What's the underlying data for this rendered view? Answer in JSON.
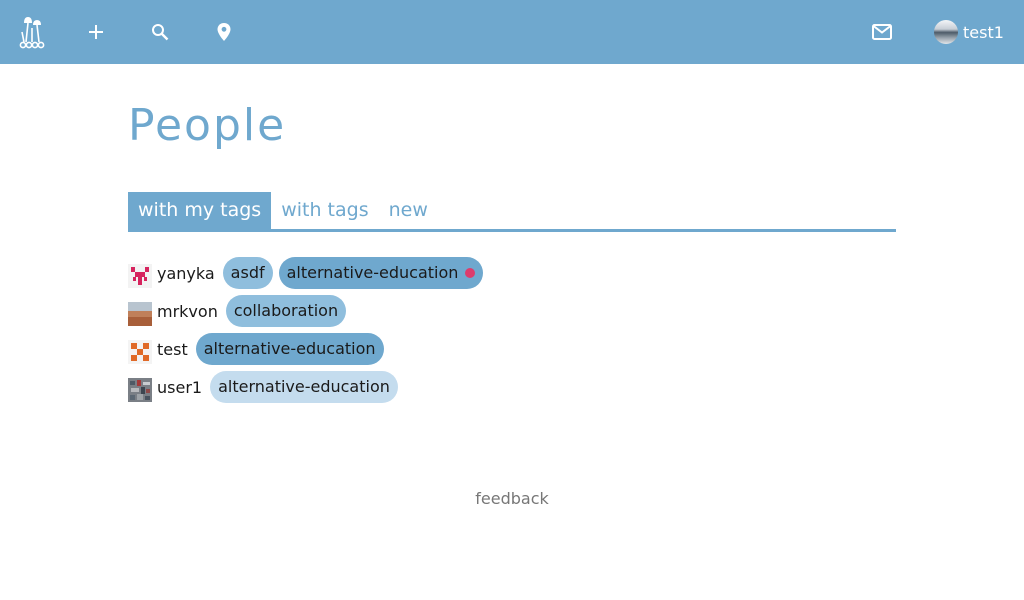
{
  "header": {
    "icons": [
      "mushrooms-logo-icon",
      "plus-icon",
      "search-icon",
      "map-pin-icon",
      "mail-icon"
    ],
    "username": "test1"
  },
  "page": {
    "title": "People"
  },
  "tabs": [
    {
      "label": "with my tags",
      "active": true
    },
    {
      "label": "with tags",
      "active": false
    },
    {
      "label": "new",
      "active": false
    }
  ],
  "people": [
    {
      "name": "yanyka",
      "tags": [
        "asdf",
        "alternative-education"
      ]
    },
    {
      "name": "mrkvon",
      "tags": [
        "collaboration"
      ]
    },
    {
      "name": "test",
      "tags": [
        "alternative-education"
      ]
    },
    {
      "name": "user1",
      "tags": [
        "alternative-education"
      ]
    }
  ],
  "footer": {
    "feedback_label": "feedback"
  },
  "colors": {
    "accent": "#6fa8ce",
    "tag_light": "#8fbedd",
    "tag_pale": "#c4dcee",
    "notify_dot": "#dd3c6c"
  }
}
